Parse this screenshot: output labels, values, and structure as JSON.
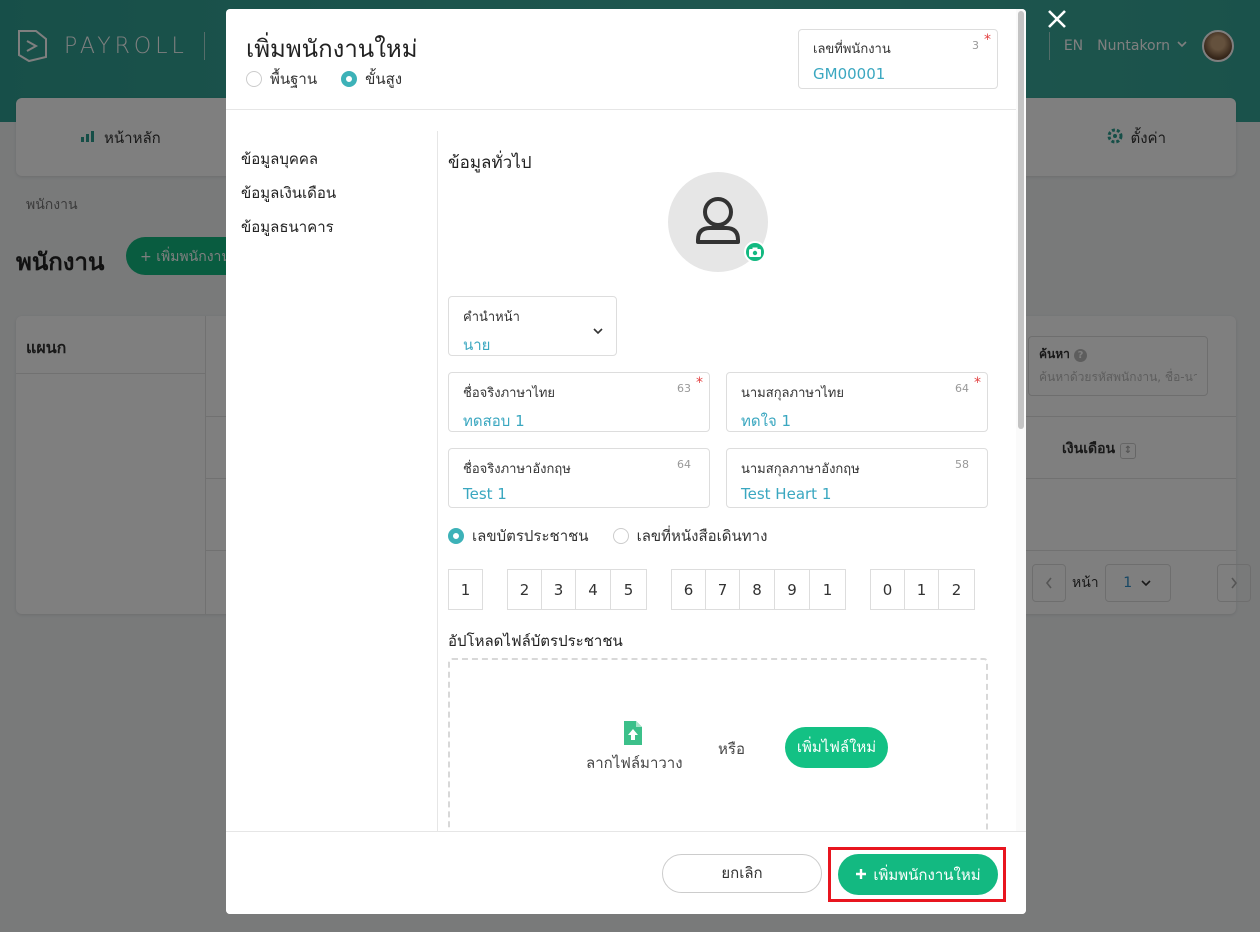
{
  "app": {
    "logo_text": "PAYROLL",
    "lang": "EN",
    "user_name": "Nuntakorn"
  },
  "nav": {
    "home": "หน้าหลัก",
    "settings": "ตั้งค่า"
  },
  "page": {
    "breadcrumb": "พนักงาน",
    "title": "พนักงาน",
    "add_button": "เพิ่มพนักงาน"
  },
  "table": {
    "dept_header": "แผนก",
    "search_label": "ค้นหา",
    "search_placeholder": "ค้นหาด้วยรหัสพนักงาน, ชื่อ-นามสกุล",
    "salary_header": "เงินเดือน",
    "page_label": "หน้า",
    "page_value": "1"
  },
  "modal": {
    "title": "เพิ่มพนักงานใหม่",
    "mode_basic": "พื้นฐาน",
    "mode_advanced": "ขั้นสูง",
    "employee_no": {
      "label": "เลขที่พนักงาน",
      "count": "3",
      "value": "GM00001"
    },
    "side_nav": [
      "ข้อมูลบุคคล",
      "ข้อมูลเงินเดือน",
      "ข้อมูลธนาคาร"
    ],
    "section_title": "ข้อมูลทั่วไป",
    "prefix": {
      "label": "คำนำหน้า",
      "value": "นาย"
    },
    "first_name_th": {
      "label": "ชื่อจริงภาษาไทย",
      "count": "63",
      "value": "ทดสอบ 1"
    },
    "last_name_th": {
      "label": "นามสกุลภาษาไทย",
      "count": "64",
      "value": "ทดใจ 1"
    },
    "first_name_en": {
      "label": "ชื่อจริงภาษาอังกฤษ",
      "count": "64",
      "value": "Test 1"
    },
    "last_name_en": {
      "label": "นามสกุลภาษาอังกฤษ",
      "count": "58",
      "value": "Test Heart 1"
    },
    "id_type_citizen": "เลขบัตรประชาชน",
    "id_type_passport": "เลขที่หนังสือเดินทาง",
    "id_digits": [
      "1",
      "2",
      "3",
      "4",
      "5",
      "6",
      "7",
      "8",
      "9",
      "1",
      "0",
      "1",
      "2"
    ],
    "upload_title": "อัปโหลดไฟล์บัตรประชาชน",
    "drag_text": "ลากไฟล์มาวาง",
    "or_text": "หรือ",
    "add_file_button": "เพิ่มไฟล์ใหม่",
    "cancel_button": "ยกเลิก",
    "submit_button": "เพิ่มพนักงานใหม่"
  },
  "colors": {
    "brand_teal": "#3aa89a",
    "accent_green": "#13b981",
    "link_blue": "#3aa7c0",
    "highlight_red": "#e8151f"
  }
}
